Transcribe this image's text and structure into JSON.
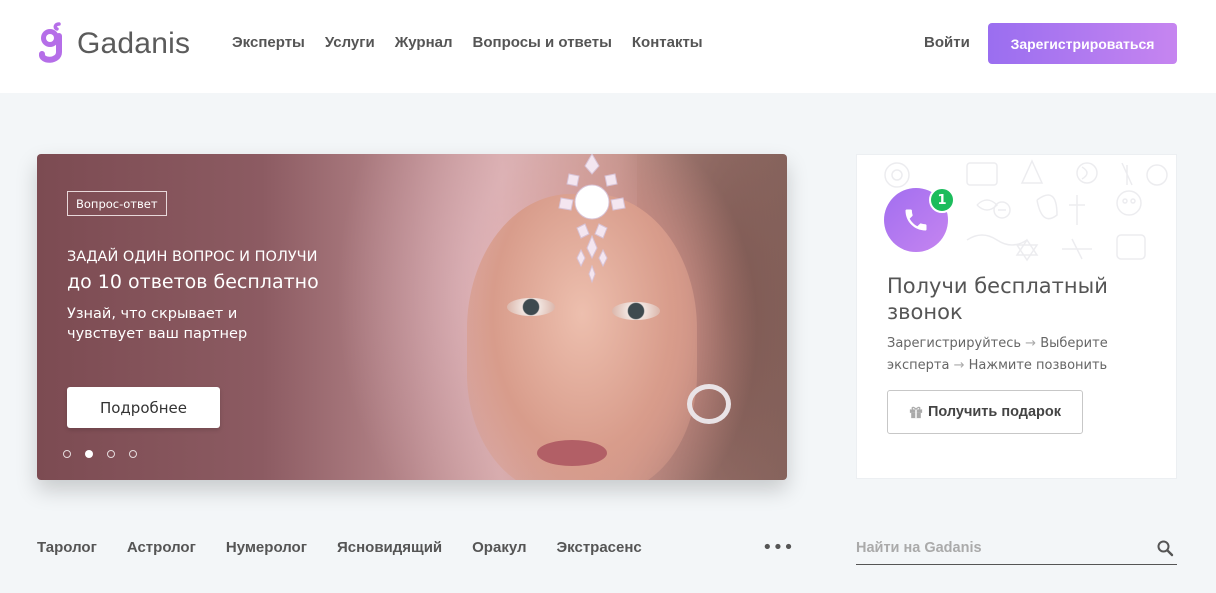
{
  "header": {
    "logo_text": "Gadanis",
    "nav": [
      "Эксперты",
      "Услуги",
      "Журнал",
      "Вопросы и ответы",
      "Контакты"
    ],
    "login_label": "Войти",
    "register_label": "Зарегистрироваться"
  },
  "hero": {
    "badge": "Вопрос-ответ",
    "subtitle": "ЗАДАЙ ОДИН ВОПРОС И ПОЛУЧИ",
    "title": "до 10 ответов бесплатно",
    "text": "Узнай, что скрывает и чувствует ваш партнер",
    "button_label": "Подробнее",
    "slides_total": 4,
    "active_slide": 2
  },
  "card": {
    "notification_count": "1",
    "title": "Получи бесплатный звонок",
    "step1": "Зарегистрируйтесь",
    "step2": "Выберите эксперта",
    "step3": "Нажмите позвонить",
    "arrow": "→",
    "gift_button_label": "Получить подарок"
  },
  "categories": [
    "Таролог",
    "Астролог",
    "Нумеролог",
    "Ясновидящий",
    "Оракул",
    "Экстрасенс"
  ],
  "more_label": "•••",
  "search": {
    "placeholder": "Найти на Gadanis",
    "value": ""
  },
  "colors": {
    "accent_start": "#9a6ef0",
    "accent_end": "#c685f0",
    "badge_green": "#1cbc5c",
    "page_bg": "#f3f6f8"
  },
  "icons": {
    "logo": "gadanis-logo-icon",
    "phone": "phone-icon",
    "gift": "gift-icon",
    "search": "search-icon"
  }
}
